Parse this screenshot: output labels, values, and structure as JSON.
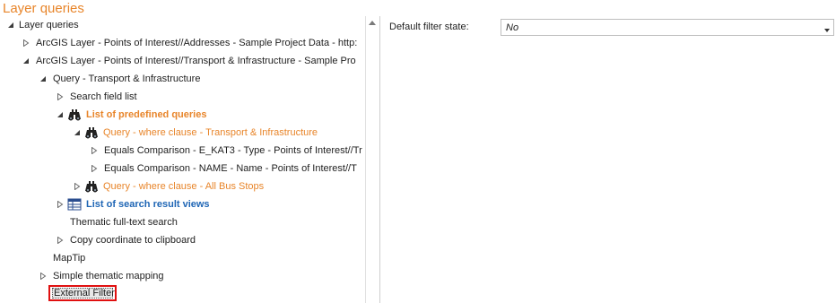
{
  "header": {
    "title": "Layer queries"
  },
  "tree": {
    "root": "Layer queries",
    "layer_addresses": "ArcGIS Layer - Points of Interest//Addresses - Sample Project Data - http:",
    "layer_transport": "ArcGIS Layer - Points of Interest//Transport & Infrastructure - Sample Pro",
    "query_transport": "Query - Transport & Infrastructure",
    "search_field_list": "Search field list",
    "predefined_queries": "List of predefined queries",
    "where_transport": "Query - where clause - Transport & Infrastructure",
    "eq_kat3": "Equals Comparison - E_KAT3 - Type - Points of Interest//Tr",
    "eq_name": "Equals Comparison - NAME - Name - Points of Interest//T",
    "where_bus": "Query - where clause - All Bus Stops",
    "search_result_views": "List of search result views",
    "fulltext": "Thematic full-text search",
    "copy_coord": "Copy coordinate to clipboard",
    "maptip": "MapTip",
    "thematic_mapping": "Simple thematic mapping",
    "external_filter": "External Filter"
  },
  "properties": {
    "default_filter_label": "Default filter state:",
    "default_filter_value": "No"
  },
  "colors": {
    "accent_orange": "#e8852a",
    "link_blue": "#1f66b5",
    "selection_border": "#e01010"
  },
  "icons": {
    "expanded": "triangle-down-filled",
    "collapsed": "triangle-right-outline",
    "binoculars": "binoculars-icon",
    "table": "table-icon"
  }
}
